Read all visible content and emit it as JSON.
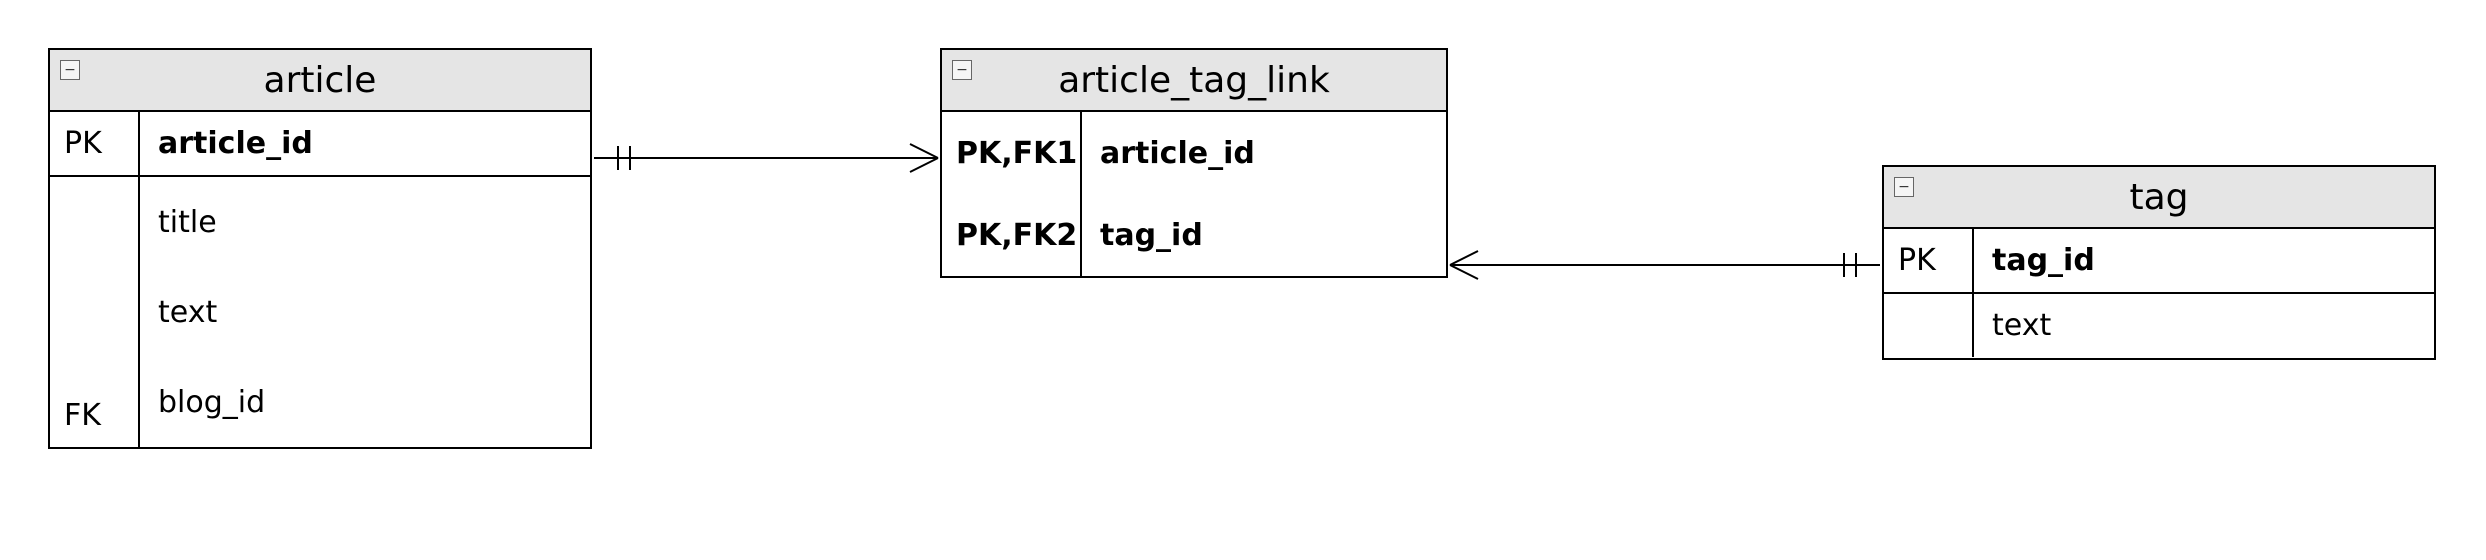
{
  "entities": {
    "article": {
      "title": "article",
      "pk_row": {
        "key": "PK",
        "field": "article_id"
      },
      "rows": [
        {
          "key": "",
          "field": "title"
        },
        {
          "key": "",
          "field": "text"
        },
        {
          "key": "FK",
          "field": "blog_id"
        }
      ]
    },
    "article_tag_link": {
      "title": "article_tag_link",
      "rows": [
        {
          "key": "PK,FK1",
          "field": "article_id"
        },
        {
          "key": "PK,FK2",
          "field": "tag_id"
        }
      ]
    },
    "tag": {
      "title": "tag",
      "pk_row": {
        "key": "PK",
        "field": "tag_id"
      },
      "rows": [
        {
          "key": "",
          "field": "text"
        }
      ]
    }
  },
  "collapse_glyph": "−",
  "chart_data": {
    "type": "entity-relationship-diagram",
    "entities": [
      {
        "name": "article",
        "primary_keys": [
          "article_id"
        ],
        "columns": [
          {
            "name": "article_id",
            "keys": [
              "PK"
            ]
          },
          {
            "name": "title",
            "keys": []
          },
          {
            "name": "text",
            "keys": []
          },
          {
            "name": "blog_id",
            "keys": [
              "FK"
            ]
          }
        ]
      },
      {
        "name": "article_tag_link",
        "primary_keys": [
          "article_id",
          "tag_id"
        ],
        "columns": [
          {
            "name": "article_id",
            "keys": [
              "PK",
              "FK1"
            ]
          },
          {
            "name": "tag_id",
            "keys": [
              "PK",
              "FK2"
            ]
          }
        ]
      },
      {
        "name": "tag",
        "primary_keys": [
          "tag_id"
        ],
        "columns": [
          {
            "name": "tag_id",
            "keys": [
              "PK"
            ]
          },
          {
            "name": "text",
            "keys": []
          }
        ]
      }
    ],
    "relationships": [
      {
        "from": "article",
        "to": "article_tag_link",
        "from_cardinality": "one-and-only-one",
        "to_cardinality": "zero-or-many"
      },
      {
        "from": "tag",
        "to": "article_tag_link",
        "from_cardinality": "one-and-only-one",
        "to_cardinality": "zero-or-many"
      }
    ]
  }
}
